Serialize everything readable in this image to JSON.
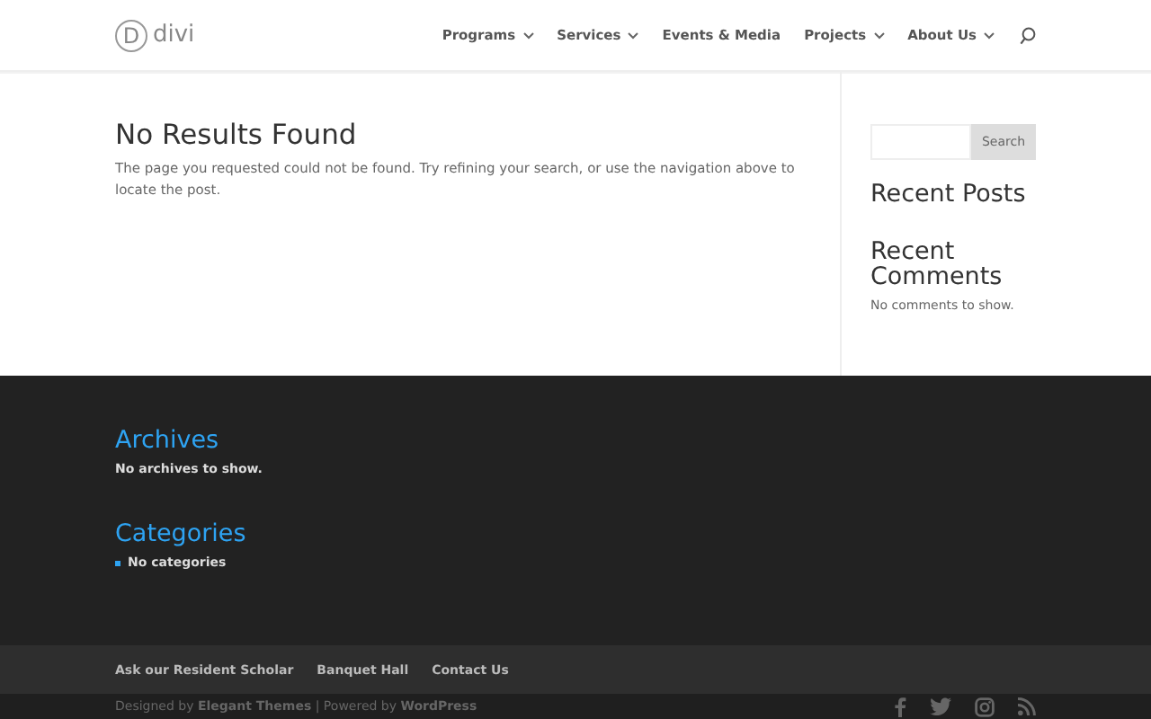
{
  "header": {
    "logo_text": "divi",
    "logo_letter": "D",
    "nav": [
      {
        "label": "Programs",
        "dropdown": true
      },
      {
        "label": "Services",
        "dropdown": true
      },
      {
        "label": "Events & Media",
        "dropdown": false
      },
      {
        "label": "Projects",
        "dropdown": true
      },
      {
        "label": "About Us",
        "dropdown": true
      }
    ]
  },
  "main": {
    "title": "No Results Found",
    "message": "The page you requested could not be found. Try refining your search, or use the navigation above to locate the post."
  },
  "sidebar": {
    "search_button": "Search",
    "recent_posts_title": "Recent Posts",
    "recent_comments_title": "Recent Comments",
    "recent_comments_empty": "No comments to show."
  },
  "footer_widgets": {
    "archives_title": "Archives",
    "archives_empty": "No archives to show.",
    "categories_title": "Categories",
    "categories": [
      "No categories"
    ]
  },
  "footer_nav": [
    "Ask our Resident Scholar",
    "Banquet Hall",
    "Contact Us"
  ],
  "credits": [
    {
      "text": "Designed by ",
      "link": false
    },
    {
      "text": "Elegant Themes",
      "link": true
    },
    {
      "text": " | Powered by ",
      "link": false
    },
    {
      "text": "WordPress",
      "link": true
    }
  ]
}
